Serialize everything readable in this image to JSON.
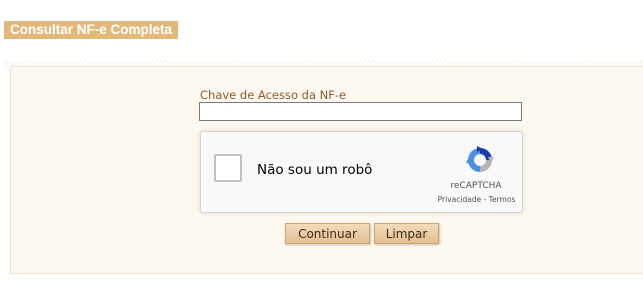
{
  "header": {
    "title": "Consultar NF-e Completa"
  },
  "form": {
    "key_label": "Chave de Acesso da NF-e",
    "key_value": "",
    "captcha": {
      "checkbox_label": "Não sou um robô",
      "brand": "reCAPTCHA",
      "privacy_link": "Privacidade",
      "separator": " - ",
      "terms_link": "Termos",
      "checked": false
    },
    "buttons": {
      "continue_label": "Continuar",
      "clear_label": "Limpar"
    }
  },
  "icons": {
    "recaptcha_logo": "recaptcha-logo-icon"
  },
  "colors": {
    "title_bg": "#e2b97b",
    "label_text": "#8a5a2b",
    "panel_bg": "#fdf9f0",
    "button_bg": "#e8c898"
  }
}
